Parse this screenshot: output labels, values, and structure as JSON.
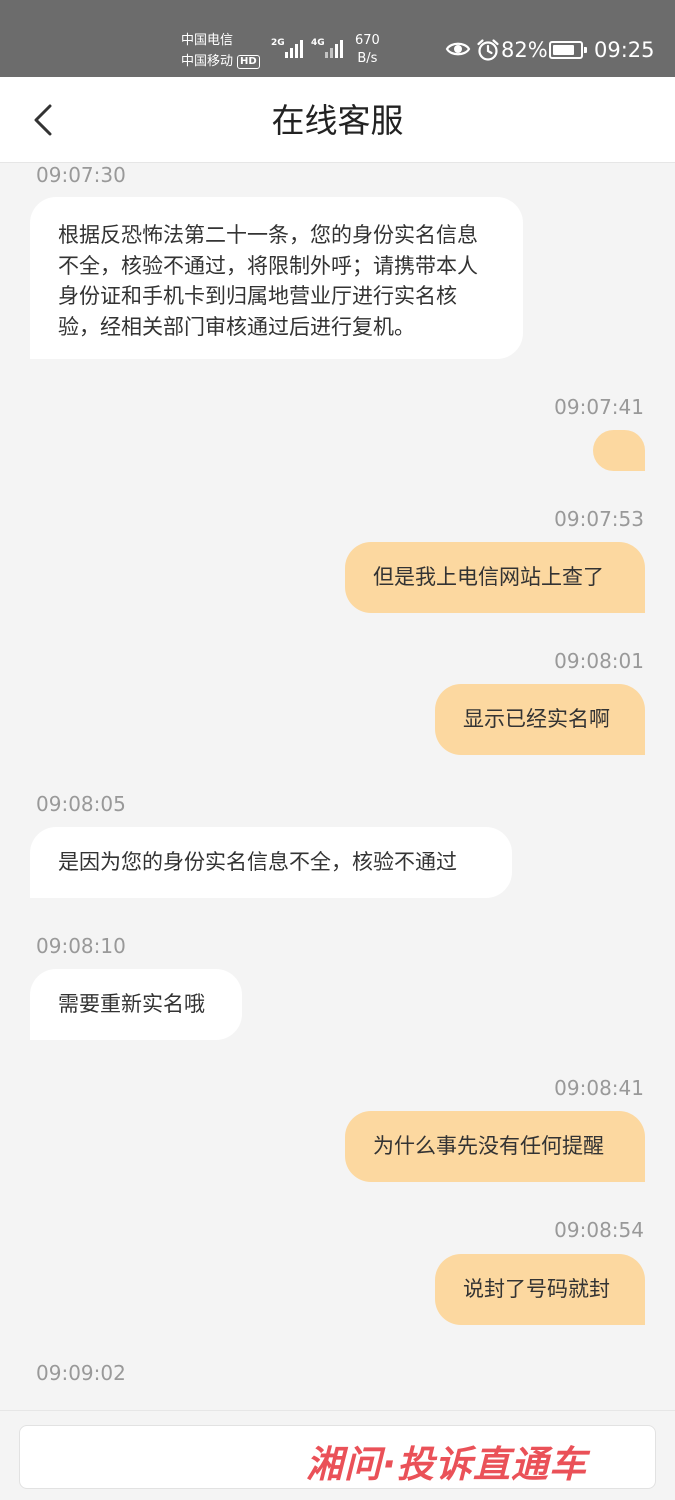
{
  "status_bar": {
    "carrier_1": "中国电信",
    "carrier_2": "中国移动",
    "hd_badge": "HD",
    "signal_1_tag": "2G",
    "signal_2_tag": "4G",
    "net_speed_value": "670",
    "net_speed_unit": "B/s",
    "battery_percent": "82%",
    "battery_level": 0.82,
    "time": "09:25"
  },
  "header": {
    "title": "在线客服"
  },
  "messages": [
    {
      "sender": "agent",
      "time": "09:07:30",
      "text": "根据反恐怖法第二十一条，您的身份实名信息不全，核验不通过，将限制外呼；请携带本人身份证和手机卡到归属地营业厅进行实名核验，经相关部门审核通过后进行复机。"
    },
    {
      "sender": "user",
      "time": "09:07:41",
      "text": ""
    },
    {
      "sender": "user",
      "time": "09:07:53",
      "text": "但是我上电信网站上查了"
    },
    {
      "sender": "user",
      "time": "09:08:01",
      "text": "显示已经实名啊"
    },
    {
      "sender": "agent",
      "time": "09:08:05",
      "text": "是因为您的身份实名信息不全，核验不通过"
    },
    {
      "sender": "agent",
      "time": "09:08:10",
      "text": "需要重新实名哦"
    },
    {
      "sender": "user",
      "time": "09:08:41",
      "text": "为什么事先没有任何提醒"
    },
    {
      "sender": "user",
      "time": "09:08:54",
      "text": "说封了号码就封"
    },
    {
      "sender": "agent",
      "time": "09:09:02",
      "text": ""
    }
  ],
  "input": {
    "placeholder": ""
  },
  "watermark": "湘问·投诉直通车",
  "colors": {
    "status_bar_bg": "#6c6c6c",
    "user_bubble": "#fcd8a0",
    "agent_bubble": "#ffffff",
    "chat_bg": "#f4f4f4",
    "timestamp": "#999999",
    "watermark": "#e9434a"
  },
  "icons": {
    "back": "chevron-left-icon",
    "eye": "eye-icon",
    "alarm": "alarm-icon",
    "battery": "battery-icon",
    "signal": "signal-bars-icon"
  }
}
